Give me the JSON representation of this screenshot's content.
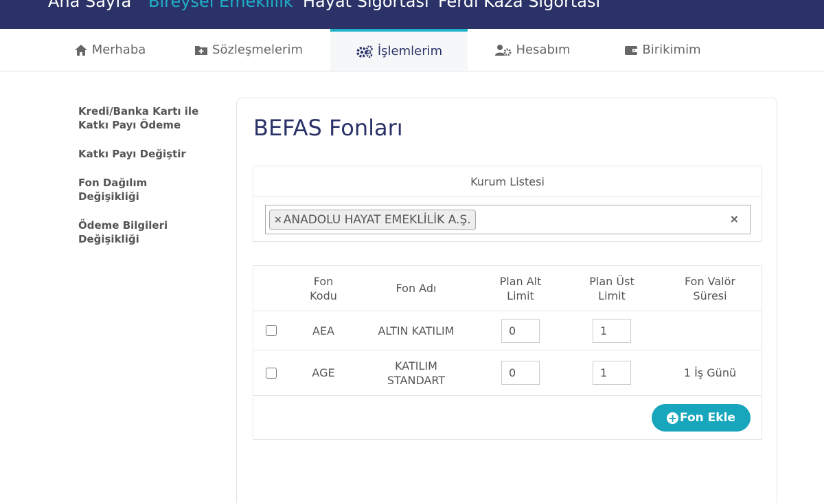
{
  "topnav": {
    "items": [
      {
        "label": "Ana Sayfa"
      },
      {
        "label": "Bireysel Emeklilik"
      },
      {
        "label": "Hayat Sigortası"
      },
      {
        "label": "Ferdi Kaza Sigortası"
      }
    ]
  },
  "subnav": {
    "tabs": [
      {
        "label": "Merhaba",
        "icon": "home-icon"
      },
      {
        "label": "Sözleşmelerim",
        "icon": "folder-plus-icon"
      },
      {
        "label": "İşlemlerim",
        "icon": "gears-icon"
      },
      {
        "label": "Hesabım",
        "icon": "user-gear-icon"
      },
      {
        "label": "Birikimim",
        "icon": "wallet-icon"
      }
    ]
  },
  "sidebar": {
    "items": [
      {
        "line1": "Kredi/Banka Kartı ile",
        "line2": "Katkı Payı Ödeme"
      },
      {
        "line1": "Katkı Payı Değiştir",
        "line2": ""
      },
      {
        "line1": "Fon Dağılım",
        "line2": "Değişikliği"
      },
      {
        "line1": "Ödeme Bilgileri",
        "line2": "Değişikliği"
      }
    ]
  },
  "main": {
    "title": "BEFAS Fonları",
    "kurum": {
      "header": "Kurum Listesi",
      "selected": "ANADOLU HAYAT EMEKLİLİK A.Ş.",
      "chip_remove": "×",
      "clear": "×"
    },
    "table": {
      "headers": {
        "fon_kodu_1": "Fon",
        "fon_kodu_2": "Kodu",
        "fon_adi": "Fon Adı",
        "alt_1": "Plan Alt",
        "alt_2": "Limit",
        "ust_1": "Plan Üst",
        "ust_2": "Limit",
        "valor_1": "Fon Valör",
        "valor_2": "Süresi"
      },
      "rows": [
        {
          "code": "AEA",
          "name1": "ALTIN KATILIM",
          "name2": "",
          "alt": "0",
          "ust": "1",
          "valor": ""
        },
        {
          "code": "AGE",
          "name1": "KATILIM",
          "name2": "STANDART",
          "alt": "0",
          "ust": "1",
          "valor": "1 İş Günü"
        }
      ],
      "add_button": "Fon Ekle"
    }
  },
  "colors": {
    "navy": "#2b3268",
    "accent": "#1fb0c8",
    "button": "#18a6bd"
  }
}
